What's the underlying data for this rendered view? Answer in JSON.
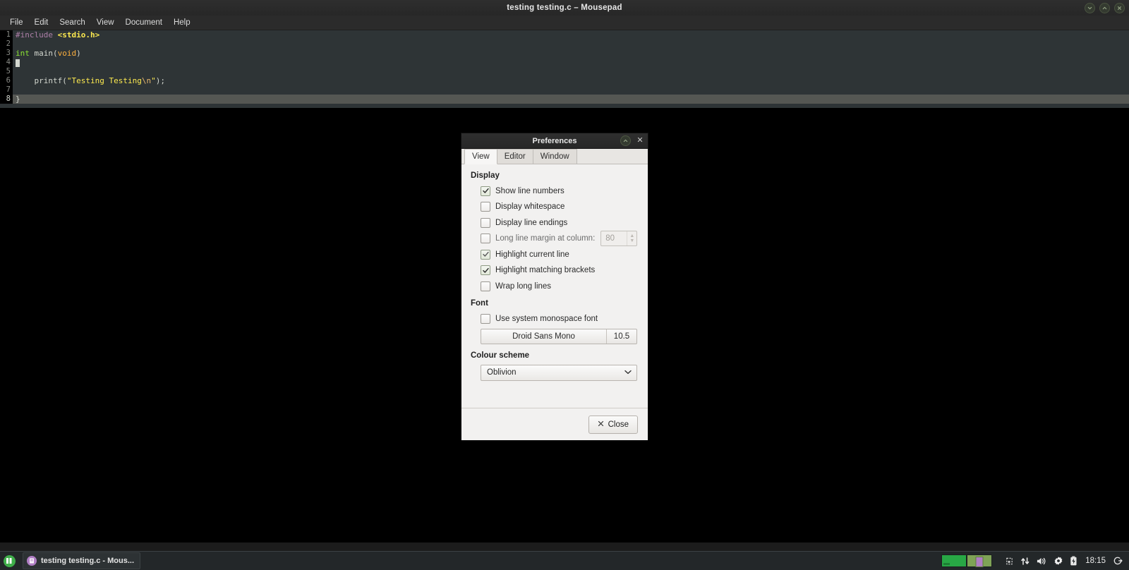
{
  "window": {
    "title": "testing testing.c – Mousepad",
    "buttons": [
      {
        "name": "minimize",
        "glyph": "⌄"
      },
      {
        "name": "maximize",
        "glyph": "⌃"
      },
      {
        "name": "close",
        "glyph": "✕"
      }
    ]
  },
  "menubar": {
    "items": [
      {
        "label": "File"
      },
      {
        "label": "Edit"
      },
      {
        "label": "Search"
      },
      {
        "label": "View"
      },
      {
        "label": "Document"
      },
      {
        "label": "Help"
      }
    ]
  },
  "editor": {
    "colour_scheme": "Oblivion",
    "current_line": 8,
    "lines": [
      {
        "num": "1",
        "text": "#include <stdio.h>"
      },
      {
        "num": "2",
        "text": ""
      },
      {
        "num": "3",
        "text": "int main(void)"
      },
      {
        "num": "4",
        "text": "{"
      },
      {
        "num": "5",
        "text": ""
      },
      {
        "num": "6",
        "text": "    printf(\"Testing Testing\\n\");"
      },
      {
        "num": "7",
        "text": ""
      },
      {
        "num": "8",
        "text": "}"
      }
    ]
  },
  "dialog": {
    "title": "Preferences",
    "titlebar_buttons": [
      {
        "name": "maximize",
        "glyph": "⌃"
      },
      {
        "name": "close",
        "glyph": "✕"
      }
    ],
    "tabs": [
      {
        "label": "View",
        "active": true
      },
      {
        "label": "Editor",
        "active": false
      },
      {
        "label": "Window",
        "active": false
      }
    ],
    "display": {
      "heading": "Display",
      "checkboxes": [
        {
          "label": "Show line numbers",
          "checked": true
        },
        {
          "label": "Display whitespace",
          "checked": false
        },
        {
          "label": "Display line endings",
          "checked": false
        },
        {
          "label": "Long line margin at column:",
          "checked": false,
          "dim": true
        },
        {
          "label": "Highlight current line",
          "checked": true
        },
        {
          "label": "Highlight matching brackets",
          "checked": true
        },
        {
          "label": "Wrap long lines",
          "checked": false
        }
      ],
      "margin_column_value": "80"
    },
    "font": {
      "heading": "Font",
      "system_font_label": "Use system monospace font",
      "system_font_checked": false,
      "font_name": "Droid Sans Mono",
      "font_size": "10.5"
    },
    "colour_scheme": {
      "heading": "Colour scheme",
      "selected": "Oblivion"
    },
    "footer": {
      "close_label": "Close"
    }
  },
  "taskbar": {
    "app_menu_name": "applications-menu",
    "task_button_label": "testing testing.c - Mous...",
    "workspaces": [
      {
        "name": "workspace-1",
        "active": false
      },
      {
        "name": "workspace-2",
        "active": true
      }
    ],
    "tray": [
      {
        "name": "clipboard-icon"
      },
      {
        "name": "network-icon"
      },
      {
        "name": "volume-icon"
      },
      {
        "name": "settings-gear-icon"
      },
      {
        "name": "battery-icon"
      }
    ],
    "clock": "18:15",
    "logout_icon": "logout-icon"
  }
}
